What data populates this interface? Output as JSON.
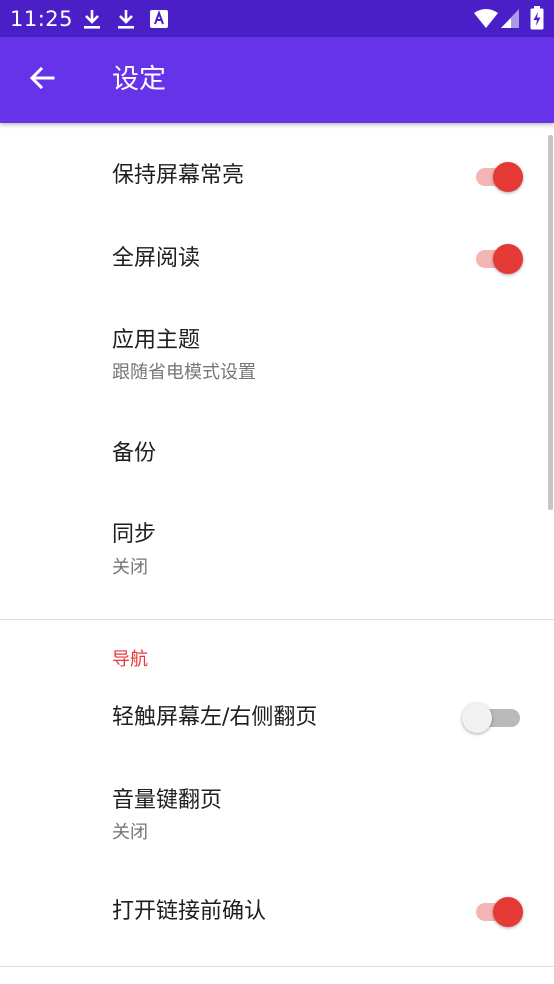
{
  "status_bar": {
    "time": "11:25",
    "left_icons": [
      "download-icon",
      "download-icon",
      "keyboard-a-icon"
    ],
    "right_icons": [
      "wifi-icon",
      "signal-icon",
      "battery-charging-icon"
    ],
    "background": "#4a1fc8"
  },
  "app_bar": {
    "title": "设定",
    "back_icon": "arrow-back-icon",
    "background": "#6633ea"
  },
  "colors": {
    "accent": "#e53935",
    "switch_track_on": "#f4b6b4"
  },
  "settings": [
    {
      "title": "保持屏幕常亮",
      "switch": true
    },
    {
      "title": "全屏阅读",
      "switch": true
    },
    {
      "title": "应用主题",
      "summary": "跟随省电模式设置"
    },
    {
      "title": "备份"
    },
    {
      "title": "同步",
      "summary": "关闭"
    }
  ],
  "navigation_section": {
    "header": "导航",
    "items": [
      {
        "title": "轻触屏幕左/右侧翻页",
        "switch": false
      },
      {
        "title": "音量键翻页",
        "summary": "关闭"
      },
      {
        "title": "打开链接前确认",
        "switch": true
      }
    ]
  }
}
